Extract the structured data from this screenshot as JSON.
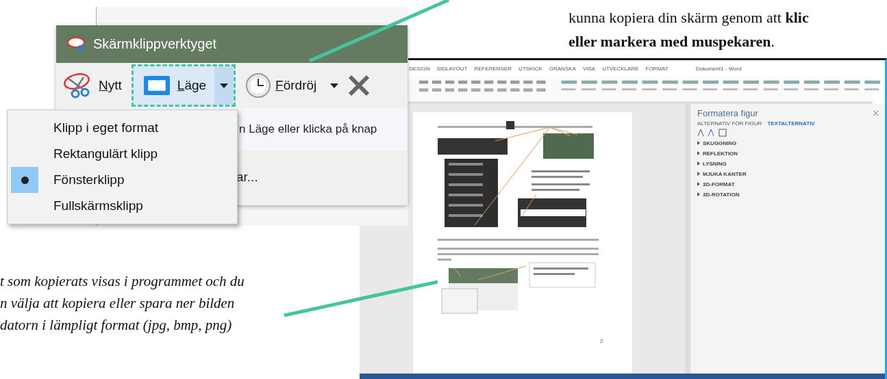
{
  "snipping_tool": {
    "title": "Skärmklippverktyget",
    "toolbar": [
      {
        "kind": "new",
        "label": "Nytt"
      },
      {
        "kind": "mode",
        "label": "Läge"
      },
      {
        "kind": "delay",
        "label": "Fördröj"
      },
      {
        "kind": "cancel"
      }
    ],
    "instruction_fragments": [
      "n Läge eller klicka på knap",
      "ar..."
    ],
    "mode_menu": [
      {
        "label": "Klipp i eget format",
        "selected": false
      },
      {
        "label": "Rektangulärt klipp",
        "selected": false
      },
      {
        "label": "Fönsterklipp",
        "selected": true
      },
      {
        "label": "Fullskärmsklipp",
        "selected": false
      }
    ]
  },
  "callout_top": {
    "lines": [
      "kunna kopiera din skärm genom att **klic**",
      "**eller markera med muspekaren**."
    ]
  },
  "callout_bottom": {
    "lines": [
      "t som kopierats visas i programmet och du",
      "n välja att  kopiera eller spara ner bilden",
      "datorn i lämpligt format (jpg, bmp, png)"
    ]
  },
  "word_window": {
    "title": "Dokument1 - Word",
    "ribbon_tabs": [
      "DESIGN",
      "SIDLAYOUT",
      "REFERENSER",
      "UTSKICK",
      "GRANSKA",
      "VISA",
      "UTVECKLARE",
      "FORMAT"
    ],
    "page_number": "2",
    "format_pane": {
      "title": "Formatera figur",
      "tabs": [
        {
          "label": "ALTERNATIV FÖR FIGUR",
          "selected": false
        },
        {
          "label": "TEXTALTERNATIV",
          "selected": true
        }
      ],
      "sections": [
        "SKUGGNING",
        "REFLEKTION",
        "LYSNING",
        "MJUKA KANTER",
        "3D-FORMAT",
        "3D-ROTATION"
      ]
    }
  }
}
